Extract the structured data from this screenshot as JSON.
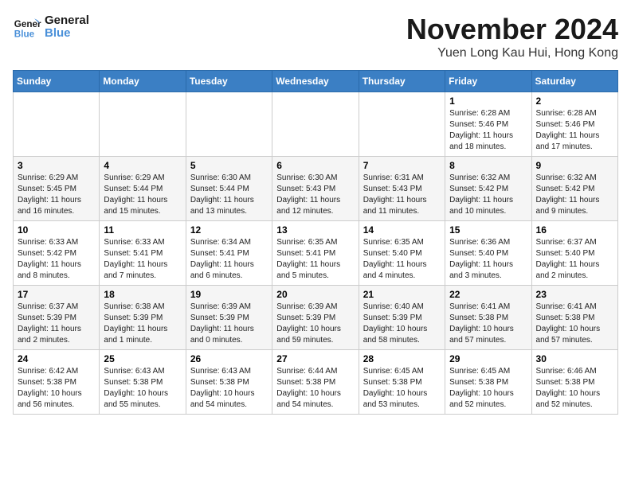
{
  "logo": {
    "line1": "General",
    "line2": "Blue"
  },
  "title": "November 2024",
  "location": "Yuen Long Kau Hui, Hong Kong",
  "weekdays": [
    "Sunday",
    "Monday",
    "Tuesday",
    "Wednesday",
    "Thursday",
    "Friday",
    "Saturday"
  ],
  "weeks": [
    [
      {
        "day": "",
        "info": ""
      },
      {
        "day": "",
        "info": ""
      },
      {
        "day": "",
        "info": ""
      },
      {
        "day": "",
        "info": ""
      },
      {
        "day": "",
        "info": ""
      },
      {
        "day": "1",
        "info": "Sunrise: 6:28 AM\nSunset: 5:46 PM\nDaylight: 11 hours and 18 minutes."
      },
      {
        "day": "2",
        "info": "Sunrise: 6:28 AM\nSunset: 5:46 PM\nDaylight: 11 hours and 17 minutes."
      }
    ],
    [
      {
        "day": "3",
        "info": "Sunrise: 6:29 AM\nSunset: 5:45 PM\nDaylight: 11 hours and 16 minutes."
      },
      {
        "day": "4",
        "info": "Sunrise: 6:29 AM\nSunset: 5:44 PM\nDaylight: 11 hours and 15 minutes."
      },
      {
        "day": "5",
        "info": "Sunrise: 6:30 AM\nSunset: 5:44 PM\nDaylight: 11 hours and 13 minutes."
      },
      {
        "day": "6",
        "info": "Sunrise: 6:30 AM\nSunset: 5:43 PM\nDaylight: 11 hours and 12 minutes."
      },
      {
        "day": "7",
        "info": "Sunrise: 6:31 AM\nSunset: 5:43 PM\nDaylight: 11 hours and 11 minutes."
      },
      {
        "day": "8",
        "info": "Sunrise: 6:32 AM\nSunset: 5:42 PM\nDaylight: 11 hours and 10 minutes."
      },
      {
        "day": "9",
        "info": "Sunrise: 6:32 AM\nSunset: 5:42 PM\nDaylight: 11 hours and 9 minutes."
      }
    ],
    [
      {
        "day": "10",
        "info": "Sunrise: 6:33 AM\nSunset: 5:42 PM\nDaylight: 11 hours and 8 minutes."
      },
      {
        "day": "11",
        "info": "Sunrise: 6:33 AM\nSunset: 5:41 PM\nDaylight: 11 hours and 7 minutes."
      },
      {
        "day": "12",
        "info": "Sunrise: 6:34 AM\nSunset: 5:41 PM\nDaylight: 11 hours and 6 minutes."
      },
      {
        "day": "13",
        "info": "Sunrise: 6:35 AM\nSunset: 5:41 PM\nDaylight: 11 hours and 5 minutes."
      },
      {
        "day": "14",
        "info": "Sunrise: 6:35 AM\nSunset: 5:40 PM\nDaylight: 11 hours and 4 minutes."
      },
      {
        "day": "15",
        "info": "Sunrise: 6:36 AM\nSunset: 5:40 PM\nDaylight: 11 hours and 3 minutes."
      },
      {
        "day": "16",
        "info": "Sunrise: 6:37 AM\nSunset: 5:40 PM\nDaylight: 11 hours and 2 minutes."
      }
    ],
    [
      {
        "day": "17",
        "info": "Sunrise: 6:37 AM\nSunset: 5:39 PM\nDaylight: 11 hours and 2 minutes."
      },
      {
        "day": "18",
        "info": "Sunrise: 6:38 AM\nSunset: 5:39 PM\nDaylight: 11 hours and 1 minute."
      },
      {
        "day": "19",
        "info": "Sunrise: 6:39 AM\nSunset: 5:39 PM\nDaylight: 11 hours and 0 minutes."
      },
      {
        "day": "20",
        "info": "Sunrise: 6:39 AM\nSunset: 5:39 PM\nDaylight: 10 hours and 59 minutes."
      },
      {
        "day": "21",
        "info": "Sunrise: 6:40 AM\nSunset: 5:39 PM\nDaylight: 10 hours and 58 minutes."
      },
      {
        "day": "22",
        "info": "Sunrise: 6:41 AM\nSunset: 5:38 PM\nDaylight: 10 hours and 57 minutes."
      },
      {
        "day": "23",
        "info": "Sunrise: 6:41 AM\nSunset: 5:38 PM\nDaylight: 10 hours and 57 minutes."
      }
    ],
    [
      {
        "day": "24",
        "info": "Sunrise: 6:42 AM\nSunset: 5:38 PM\nDaylight: 10 hours and 56 minutes."
      },
      {
        "day": "25",
        "info": "Sunrise: 6:43 AM\nSunset: 5:38 PM\nDaylight: 10 hours and 55 minutes."
      },
      {
        "day": "26",
        "info": "Sunrise: 6:43 AM\nSunset: 5:38 PM\nDaylight: 10 hours and 54 minutes."
      },
      {
        "day": "27",
        "info": "Sunrise: 6:44 AM\nSunset: 5:38 PM\nDaylight: 10 hours and 54 minutes."
      },
      {
        "day": "28",
        "info": "Sunrise: 6:45 AM\nSunset: 5:38 PM\nDaylight: 10 hours and 53 minutes."
      },
      {
        "day": "29",
        "info": "Sunrise: 6:45 AM\nSunset: 5:38 PM\nDaylight: 10 hours and 52 minutes."
      },
      {
        "day": "30",
        "info": "Sunrise: 6:46 AM\nSunset: 5:38 PM\nDaylight: 10 hours and 52 minutes."
      }
    ]
  ]
}
